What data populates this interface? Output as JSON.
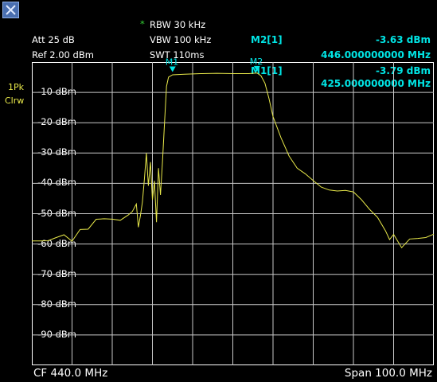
{
  "logo": {
    "icon": "rohde-schwarz-logo-icon"
  },
  "settings": {
    "rbw_marker": "*",
    "rbw": "RBW 30 kHz",
    "vbw": "VBW 100 kHz",
    "swt": "SWT 110ms",
    "att": "Att  25 dB",
    "ref": "Ref  2.00 dBm"
  },
  "trace_label": {
    "line1": "1Pk",
    "line2": "Clrw"
  },
  "marker_readouts": [
    {
      "name": "M2[1]",
      "level": "-3.63 dBm",
      "freq": "446.000000000 MHz"
    },
    {
      "name": "M1[1]",
      "level": "-3.79 dBm",
      "freq": "425.000000000 MHz"
    }
  ],
  "colors": {
    "trace": "#e8e84a",
    "marker": "#00e5e5",
    "grid": "#c8c8c8"
  },
  "footer": {
    "cf": "CF 440.0 MHz",
    "span": "Span 100.0 MHz"
  },
  "chart_data": {
    "type": "line",
    "xlabel": "",
    "ylabel": "",
    "xlim": [
      390,
      490
    ],
    "ylim": [
      -100,
      0
    ],
    "y_ticks": [
      -10,
      -20,
      -30,
      -40,
      -50,
      -60,
      -70,
      -80,
      -90
    ],
    "y_tick_labels": [
      "-10 dBm",
      "-20 dBm",
      "-30 dBm",
      "-40 dBm",
      "-50 dBm",
      "-60 dBm",
      "-70 dBm",
      "-80 dBm",
      "-90 dBm"
    ],
    "grid": true,
    "markers": [
      {
        "label": "M1",
        "x": 425.0,
        "y": -3.79
      },
      {
        "label": "M2",
        "x": 446.0,
        "y": -3.63
      }
    ],
    "series": [
      {
        "x": [
          390,
          392,
          394,
          396,
          398,
          400,
          402,
          404,
          406,
          408,
          410,
          412,
          414,
          415,
          416,
          416.5,
          417,
          417.5,
          418,
          418.5,
          419,
          419.5,
          420,
          420.5,
          421,
          421.5,
          422,
          422.5,
          423,
          423.5,
          424,
          425,
          428,
          432,
          436,
          440,
          444,
          446,
          447,
          448,
          449,
          450,
          452,
          454,
          456,
          458,
          460,
          462,
          464,
          466,
          468,
          470,
          472,
          474,
          476,
          478,
          479,
          480,
          482,
          484,
          486,
          488,
          490
        ],
        "y": [
          -59,
          -60,
          -60,
          -58,
          -56,
          -58,
          -55,
          -56,
          -53,
          -52,
          -51,
          -51,
          -50,
          -50,
          -48,
          -55,
          -50,
          -45,
          -38,
          -30,
          -42,
          -33,
          -45,
          -38,
          -52,
          -35,
          -45,
          -33,
          -20,
          -8,
          -5,
          -4.2,
          -4,
          -3.8,
          -3.7,
          -3.8,
          -3.8,
          -3.6,
          -4.5,
          -7,
          -12,
          -18,
          -25,
          -31,
          -35,
          -38,
          -39.5,
          -40.5,
          -41,
          -42,
          -43,
          -44,
          -46,
          -48,
          -50,
          -55,
          -59,
          -58,
          -62,
          -58,
          -57,
          -57,
          -57
        ]
      }
    ]
  }
}
